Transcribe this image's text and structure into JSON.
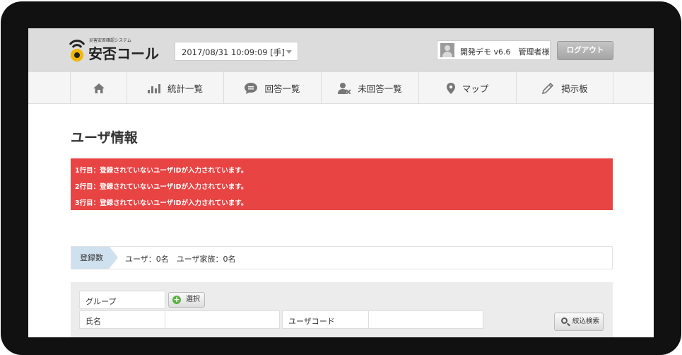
{
  "header": {
    "logo_subtitle": "災害安否確認システム",
    "logo_title": "安否コール",
    "datetime": "2017/08/31 10:09:09 [手]",
    "user": "開発デモ v6.6　管理者様",
    "logout_label": "ログアウト"
  },
  "nav": {
    "items": [
      {
        "label": "",
        "icon": "home-icon"
      },
      {
        "label": "統計一覧",
        "icon": "bar-chart-icon"
      },
      {
        "label": "回答一覧",
        "icon": "speech-bubble-icon"
      },
      {
        "label": "未回答一覧",
        "icon": "user-x-icon"
      },
      {
        "label": "マップ",
        "icon": "map-pin-icon"
      },
      {
        "label": "掲示板",
        "icon": "pencil-icon"
      }
    ]
  },
  "page": {
    "title": "ユーザ情報"
  },
  "alerts": [
    "1行目：登録されていないユーザIDが入力されています。",
    "2行目：登録されていないユーザIDが入力されています。",
    "3行目：登録されていないユーザIDが入力されています。"
  ],
  "registration": {
    "label": "登録数",
    "text": "ユーザ：0名　ユーザ家族：0名"
  },
  "search": {
    "group_label": "グループ",
    "select_label": "選択",
    "name_label": "氏名",
    "name_value": "",
    "usercode_label": "ユーザコード",
    "usercode_value": "",
    "search_label": "絞込検索"
  },
  "colors": {
    "alert": "#e84444",
    "header_bg": "#dcdcdc",
    "logo_yellow": "#f2b705",
    "select_green": "#5cb247"
  }
}
